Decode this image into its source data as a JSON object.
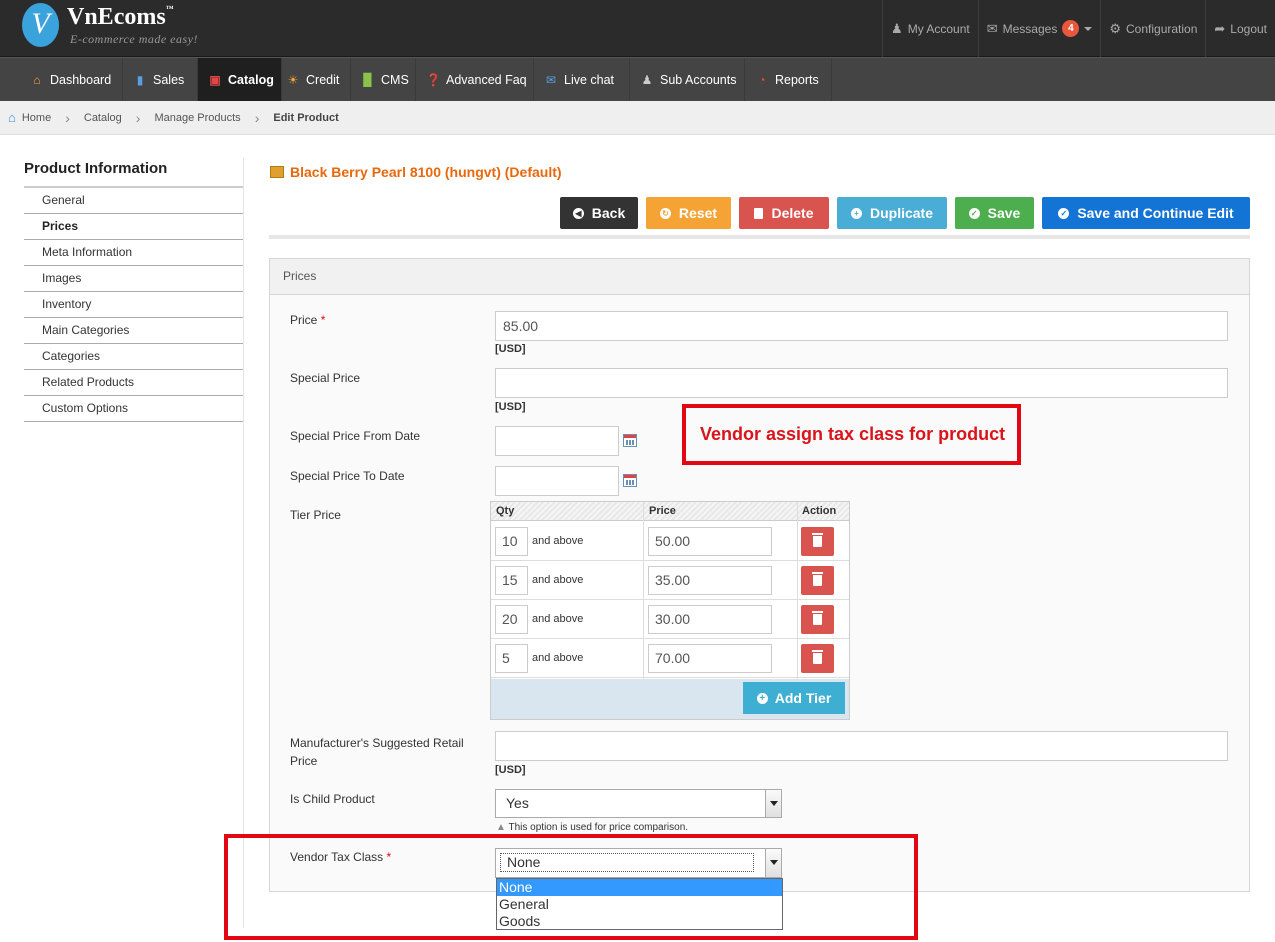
{
  "brand": {
    "name": "VnEcoms",
    "tm": "™",
    "tagline": "E-commerce made easy!",
    "logo_letter": "V"
  },
  "top_menu": {
    "my_account": "My Account",
    "messages": "Messages",
    "messages_count": "4",
    "configuration": "Configuration",
    "logout": "Logout"
  },
  "nav": [
    {
      "label": "Dashboard",
      "icon": "home-icon"
    },
    {
      "label": "Sales",
      "icon": "bar-chart-icon"
    },
    {
      "label": "Catalog",
      "icon": "gift-icon",
      "active": true
    },
    {
      "label": "Credit",
      "icon": "sun-icon"
    },
    {
      "label": "CMS",
      "icon": "page-icon"
    },
    {
      "label": "Advanced Faq",
      "icon": "question-icon"
    },
    {
      "label": "Live chat",
      "icon": "chat-icon"
    },
    {
      "label": "Sub Accounts",
      "icon": "user-icon"
    },
    {
      "label": "Reports",
      "icon": "pie-chart-icon"
    }
  ],
  "breadcrumb": [
    "Home",
    "Catalog",
    "Manage Products",
    "Edit Product"
  ],
  "sidebar": {
    "title": "Product Information",
    "items": [
      "General",
      "Prices",
      "Meta Information",
      "Images",
      "Inventory",
      "Main Categories",
      "Categories",
      "Related Products",
      "Custom Options"
    ],
    "active": "Prices"
  },
  "product_title": "Black Berry Pearl 8100 (hungvt) (Default)",
  "buttons": {
    "back": "Back",
    "reset": "Reset",
    "delete": "Delete",
    "duplicate": "Duplicate",
    "save": "Save",
    "save_continue": "Save and Continue Edit"
  },
  "colors": {
    "back": "#333333",
    "reset": "#f6a335",
    "delete": "#d9534f",
    "duplicate": "#4aadd6",
    "save": "#4cae4c",
    "save_continue": "#1474d6",
    "title_orange": "#e8680e",
    "callout_red": "#e30613"
  },
  "section_title": "Prices",
  "fields": {
    "price_label": "Price",
    "price_value": "85.00",
    "currency": "[USD]",
    "special_price_label": "Special Price",
    "special_price_value": "",
    "special_from_label": "Special Price From Date",
    "special_to_label": "Special Price To Date",
    "tier_label": "Tier Price",
    "msrp_label": "Manufacturer's Suggested Retail Price",
    "is_child_label": "Is Child Product",
    "is_child_value": "Yes",
    "is_child_note": "This option is used for price comparison.",
    "vendor_tax_label": "Vendor Tax Class",
    "vendor_tax_value": "None",
    "required_mark": "*"
  },
  "tier_table": {
    "headers": [
      "Qty",
      "Price",
      "Action"
    ],
    "suffix": "and above",
    "rows": [
      {
        "qty": "10",
        "price": "50.00"
      },
      {
        "qty": "15",
        "price": "35.00"
      },
      {
        "qty": "20",
        "price": "30.00"
      },
      {
        "qty": "5",
        "price": "70.00"
      }
    ],
    "add_label": "Add Tier"
  },
  "tax_options": [
    "None",
    "General",
    "Goods"
  ],
  "callout": "Vendor assign tax class for product"
}
